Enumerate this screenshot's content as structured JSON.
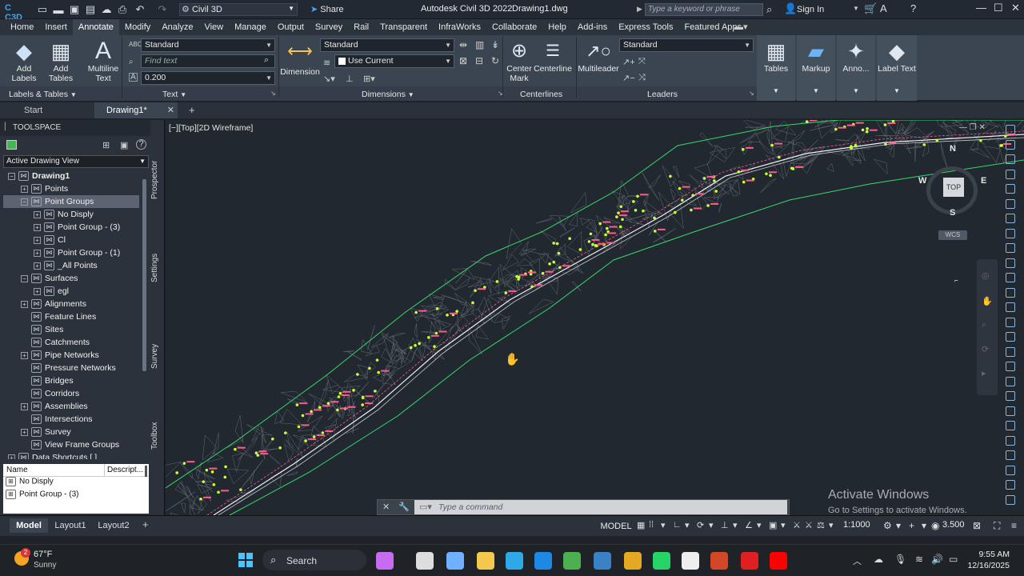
{
  "titlebar": {
    "workspace": "Civil 3D",
    "share": "Share",
    "app_title": "Autodesk Civil 3D 2022",
    "file_name": "Drawing1.dwg",
    "search_placeholder": "Type a keyword or phrase",
    "sign_in": "Sign In",
    "app_logo": "C C3D"
  },
  "menu": [
    "Home",
    "Insert",
    "Annotate",
    "Modify",
    "Analyze",
    "View",
    "Manage",
    "Output",
    "Survey",
    "Rail",
    "Transparent",
    "InfraWorks",
    "Collaborate",
    "Help",
    "Add-ins",
    "Express Tools",
    "Featured Apps"
  ],
  "ribbon": {
    "add_labels": "Add\nLabels",
    "add_tables": "Add\nTables",
    "multiline_text": "Multiline\nText",
    "text_style": "Standard",
    "find_text_placeholder": "Find text",
    "text_height": "0.200",
    "dimension": "Dimension",
    "dim_style": "Standard",
    "dim_layer": "Use Current",
    "center_mark": "Center\nMark",
    "centerline": "Centerline",
    "multileader": "Multileader",
    "leader_style": "Standard",
    "tables": "Tables",
    "markup": "Markup",
    "annotation": "Anno...",
    "label_text": "Label Text",
    "panels": {
      "labels_tables": "Labels & Tables",
      "text": "Text",
      "dimensions": "Dimensions",
      "centerlines": "Centerlines",
      "leaders": "Leaders"
    }
  },
  "doctabs": {
    "start": "Start",
    "drawing": "Drawing1*"
  },
  "toolspace": {
    "title": "TOOLSPACE",
    "view_select": "Active Drawing View",
    "tree": [
      {
        "label": "Drawing1",
        "indent": 0,
        "bold": true,
        "exp": "−"
      },
      {
        "label": "Points",
        "indent": 1,
        "exp": "+"
      },
      {
        "label": "Point Groups",
        "indent": 1,
        "exp": "−",
        "selected": true
      },
      {
        "label": "No Disply",
        "indent": 2,
        "exp": "+"
      },
      {
        "label": "Point Group - (3)",
        "indent": 2,
        "exp": "+"
      },
      {
        "label": "Cl",
        "indent": 2,
        "exp": "+"
      },
      {
        "label": "Point Group - (1)",
        "indent": 2,
        "exp": "+"
      },
      {
        "label": "_All Points",
        "indent": 2,
        "exp": "+"
      },
      {
        "label": "Surfaces",
        "indent": 1,
        "exp": "−"
      },
      {
        "label": "egl",
        "indent": 2,
        "exp": "+"
      },
      {
        "label": "Alignments",
        "indent": 1,
        "exp": "+"
      },
      {
        "label": "Feature Lines",
        "indent": 1,
        "exp": ""
      },
      {
        "label": "Sites",
        "indent": 1,
        "exp": ""
      },
      {
        "label": "Catchments",
        "indent": 1,
        "exp": ""
      },
      {
        "label": "Pipe Networks",
        "indent": 1,
        "exp": "+"
      },
      {
        "label": "Pressure Networks",
        "indent": 1,
        "exp": ""
      },
      {
        "label": "Bridges",
        "indent": 1,
        "exp": ""
      },
      {
        "label": "Corridors",
        "indent": 1,
        "exp": ""
      },
      {
        "label": "Assemblies",
        "indent": 1,
        "exp": "+"
      },
      {
        "label": "Intersections",
        "indent": 1,
        "exp": ""
      },
      {
        "label": "Survey",
        "indent": 1,
        "exp": "+"
      },
      {
        "label": "View Frame Groups",
        "indent": 1,
        "exp": ""
      },
      {
        "label": "Data Shortcuts [ ]",
        "indent": 0,
        "exp": "+"
      }
    ],
    "list_headers": [
      "Name",
      "Descript..."
    ],
    "list_rows": [
      "No Disply",
      "Point Group - (3)"
    ],
    "vertical_tabs": [
      "Prospector",
      "Settings",
      "Survey",
      "Toolbox"
    ]
  },
  "viewport": {
    "label": "[−][Top][2D Wireframe]",
    "compass": {
      "n": "N",
      "s": "S",
      "e": "E",
      "w": "W",
      "top": "TOP",
      "wcs": "WCS"
    },
    "watermark_title": "Activate Windows",
    "watermark_sub": "Go to Settings to activate Windows.",
    "command_placeholder": "Type a command"
  },
  "layoutbar": {
    "tabs": [
      "Model",
      "Layout1",
      "Layout2"
    ],
    "model_label": "MODEL",
    "scale": "1:1000",
    "elevation": "3.500"
  },
  "taskbar": {
    "weather_temp": "67°F",
    "weather_desc": "Sunny",
    "weather_badge": "2",
    "search": "Search",
    "time": "9:55 AM",
    "date": "12/16/2025"
  },
  "colors": {
    "accent": "#3b82c4",
    "surface_edge": "#39d86b",
    "points": "#c8ff3c",
    "labels": "#ff5c8a",
    "alignment": "#f2f2f2"
  }
}
